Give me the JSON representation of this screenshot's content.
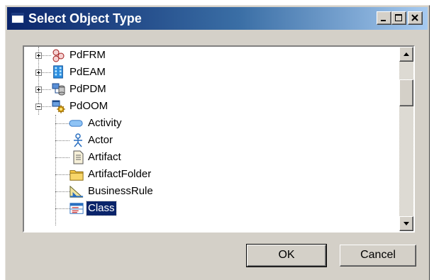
{
  "window": {
    "title": "Select Object Type",
    "controls": [
      "minimize-icon",
      "maximize-icon",
      "close-icon"
    ]
  },
  "tree": {
    "items": [
      {
        "label": "PdFRM",
        "icon": "frm-model-icon",
        "expander": "plus",
        "level": 0
      },
      {
        "label": "PdEAM",
        "icon": "eam-model-icon",
        "expander": "plus",
        "level": 0
      },
      {
        "label": "PdPDM",
        "icon": "pdm-model-icon",
        "expander": "plus",
        "level": 0
      },
      {
        "label": "PdOOM",
        "icon": "oom-model-icon",
        "expander": "minus",
        "level": 0
      },
      {
        "label": "Activity",
        "icon": "activity-icon",
        "level": 1
      },
      {
        "label": "Actor",
        "icon": "actor-icon",
        "level": 1
      },
      {
        "label": "Artifact",
        "icon": "artifact-icon",
        "level": 1
      },
      {
        "label": "ArtifactFolder",
        "icon": "folder-icon",
        "level": 1
      },
      {
        "label": "BusinessRule",
        "icon": "business-rule-icon",
        "level": 1
      },
      {
        "label": "Class",
        "icon": "class-icon",
        "level": 1,
        "selected": true
      }
    ]
  },
  "buttons": {
    "ok": "OK",
    "cancel": "Cancel"
  },
  "colors": {
    "title_gradient_start": "#0a246a",
    "title_gradient_end": "#a6caf0",
    "selection": "#0a246a",
    "face": "#d4d0c8"
  }
}
